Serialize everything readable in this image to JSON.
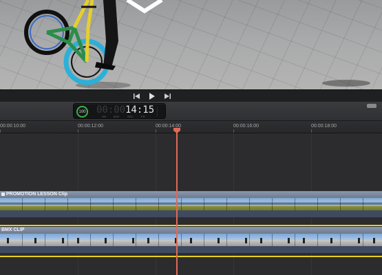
{
  "viewer": {
    "overlay_icon": "diamond-outline-icon"
  },
  "transport": {
    "buttons": [
      {
        "name": "previous-frame-button",
        "icon": "skip-back-icon"
      },
      {
        "name": "play-button",
        "icon": "play-icon"
      },
      {
        "name": "next-frame-button",
        "icon": "skip-forward-icon"
      }
    ]
  },
  "timecode": {
    "zoom_percent": "100",
    "dim_digits": "00:00",
    "bright_digits": "14:15",
    "units": {
      "hr": "HR",
      "min": "MIN",
      "sec": "SEC",
      "fr": "FR"
    }
  },
  "ruler": {
    "labels": [
      "00:00:10:00",
      "00:00:12:00",
      "00:00:14:00",
      "00:00:16:00",
      "00:00:18:00"
    ]
  },
  "clips": [
    {
      "title": "PROMOTION LESSON Clip",
      "kind": "mountain",
      "has_icon": true
    },
    {
      "title": "BMX CLIP",
      "kind": "bmx",
      "has_icon": false
    }
  ],
  "colors": {
    "playhead": "#e06a56",
    "clip_header": "#7a889f",
    "audio_line": "#e5d11f",
    "timecode_ring": "#3bb34a"
  }
}
